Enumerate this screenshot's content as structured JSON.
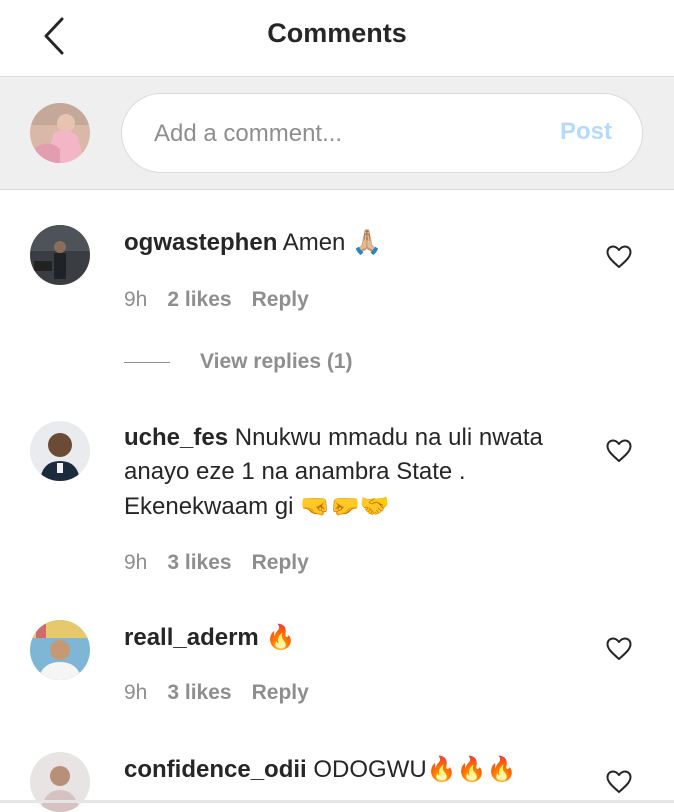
{
  "header": {
    "title": "Comments",
    "back_icon": "chevron-left-icon"
  },
  "composer": {
    "placeholder": "Add a comment...",
    "post_label": "Post",
    "post_color": "#b3dbff"
  },
  "comments": [
    {
      "username": "ogwastephen",
      "text": "Amen",
      "emoji": "🙏🏼",
      "time": "9h",
      "likes": "2 likes",
      "reply": "Reply",
      "view_replies": "View replies (1)"
    },
    {
      "username": "uche_fes",
      "text": "Nnukwu mmadu na uli nwata anayo eze 1 na anambra State . Ekenekwaam gi",
      "emoji": "🤜🤛🤝",
      "time": "9h",
      "likes": "3 likes",
      "reply": "Reply"
    },
    {
      "username": "reall_aderm",
      "text": "",
      "emoji": "🔥",
      "time": "9h",
      "likes": "3 likes",
      "reply": "Reply"
    },
    {
      "username": "confidence_odii",
      "text": "ODOGWU",
      "emoji": "🔥🔥🔥"
    }
  ],
  "colors": {
    "text": "#262626",
    "secondary": "#8e8e8e",
    "composer_bg": "#efefef"
  }
}
